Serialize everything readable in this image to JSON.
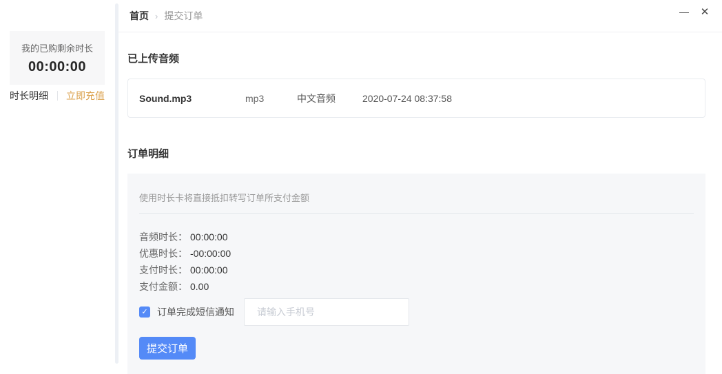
{
  "window": {
    "minimize_icon": "—",
    "close_icon": "✕"
  },
  "sidebar": {
    "balance_title": "我的已购剩余时长",
    "balance_value": "00:00:00",
    "detail_link": "时长明细",
    "recharge_link": "立即充值"
  },
  "breadcrumb": {
    "home": "首页",
    "separator": "›",
    "current": "提交订单"
  },
  "uploaded": {
    "section_title": "已上传音频",
    "file": {
      "name": "Sound.mp3",
      "format": "mp3",
      "language": "中文音频",
      "uploaded_at": "2020-07-24 08:37:58"
    }
  },
  "order": {
    "section_title": "订单明细",
    "note": "使用时长卡将直接抵扣转写订单所支付金额",
    "rows": [
      {
        "label": "音频时长：",
        "value": "00:00:00"
      },
      {
        "label": "优惠时长：",
        "value": "-00:00:00"
      },
      {
        "label": "支付时长：",
        "value": "00:00:00"
      },
      {
        "label": "支付金额：",
        "value": "0.00"
      }
    ],
    "sms": {
      "checked": true,
      "check_icon": "✓",
      "label": "订单完成短信通知",
      "placeholder": "请输入手机号"
    },
    "submit_label": "提交订单"
  },
  "colors": {
    "accent_blue": "#548af7",
    "accent_orange": "#dba14d",
    "panel_gray": "#f6f7f9"
  }
}
